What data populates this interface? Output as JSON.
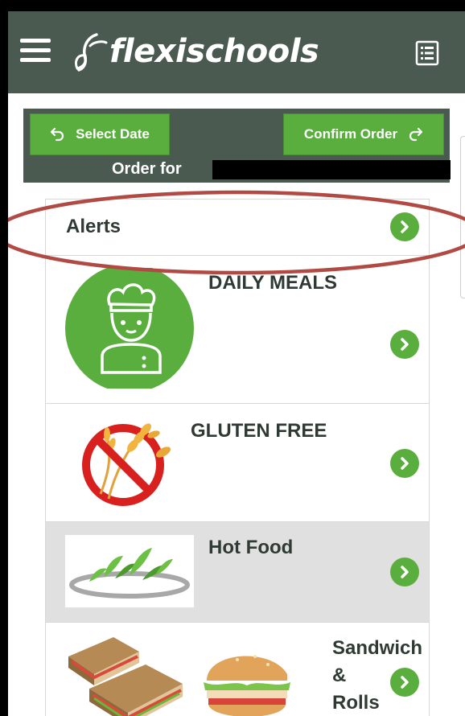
{
  "header": {
    "menu_icon": "hamburger-menu-icon",
    "logo_text": "flexischools",
    "logo_icon": "leaf-logo-icon",
    "order_list_icon": "order-list-icon"
  },
  "order_panel": {
    "select_date_label": "Select Date",
    "confirm_order_label": "Confirm Order",
    "order_for_label": "Order for"
  },
  "categories": [
    {
      "label": "Alerts",
      "icon": "chevron-right-icon"
    },
    {
      "label": "DAILY MEALS",
      "image": "chef-icon"
    },
    {
      "label": "GLUTEN FREE",
      "image": "no-wheat-icon"
    },
    {
      "label": "Hot Food",
      "image": "salad-plate-icon"
    },
    {
      "label": "Sandwich & Rolls",
      "label_lines": [
        "Sandwich",
        "&",
        "Rolls"
      ],
      "image": "sandwich-burger-photo"
    }
  ],
  "colors": {
    "topbar": "#4a5a51",
    "accent_green": "#5aae3e",
    "highlight_red": "#b24a44"
  }
}
